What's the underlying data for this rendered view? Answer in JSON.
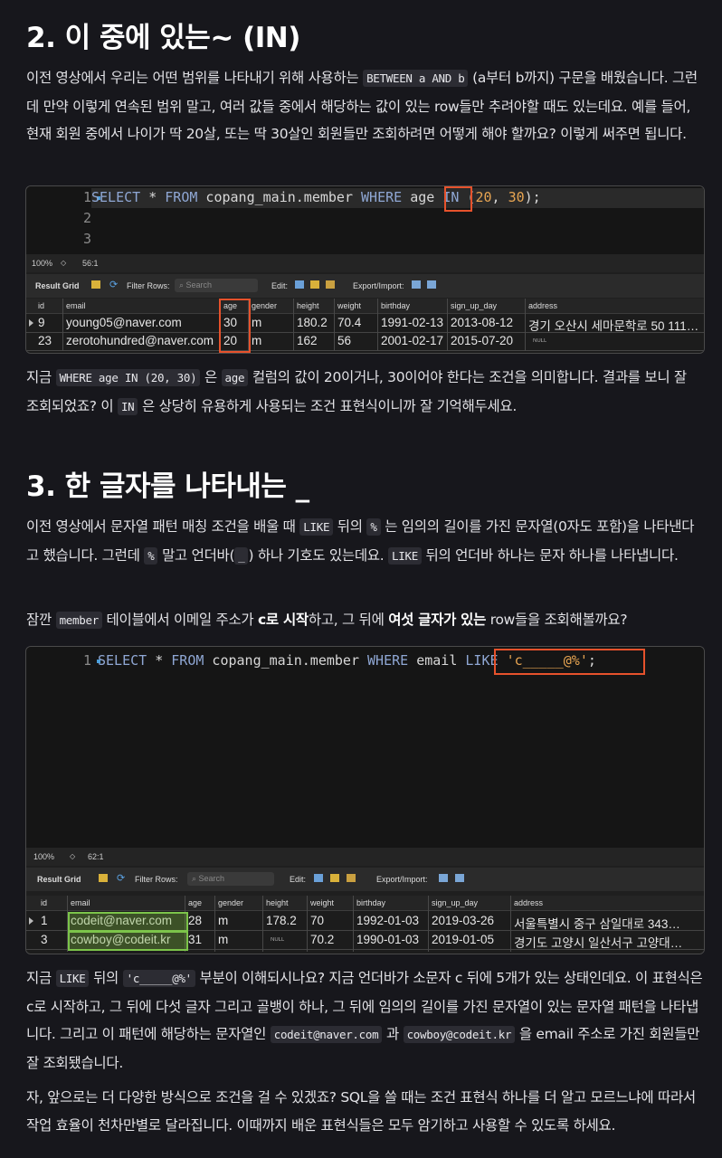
{
  "section2": {
    "title": "2. 이 중에 있는~ (IN)",
    "p1": {
      "t1": "이전 영상에서 우리는 어떤 범위를 나타내기 위해 사용하는 ",
      "code1": "BETWEEN a AND b",
      "t2": " (a부터 b까지) 구문을 배웠습니다. 그런데 만약 이렇게 연속된 범위 말고, 여러 값들 중에서 해당하는 값이 있는 row들만 추려야할 때도 있는데요. 예를 들어, 현재 회원 중에서 나이가 딱 20살, 또는 딱 30살인 회원들만 조회하려면 어떻게 해야 할까요? 이렇게 써주면 됩니다."
    },
    "shot": {
      "line_numbers": [
        "1",
        "2",
        "3"
      ],
      "code": {
        "kw1": "SELECT",
        "star": " * ",
        "kw2": "FROM",
        "tbl": " copang_main.member ",
        "kw3": "WHERE",
        "col": " age ",
        "kw4": "IN",
        "args_open": " (",
        "n1": "20",
        "comma": ", ",
        "n2": "30",
        "args_close": ");"
      },
      "zoom": "100%",
      "position": "56:1",
      "result_grid": "Result Grid",
      "filter_rows": "Filter Rows:",
      "search_placeholder": "Search",
      "edit": "Edit:",
      "export_import": "Export/Import:",
      "columns": [
        "id",
        "email",
        "age",
        "gender",
        "height",
        "weight",
        "birthday",
        "sign_up_day",
        "address"
      ],
      "rows": [
        {
          "id": "9",
          "email": "young05@naver.com",
          "age": "30",
          "gender": "m",
          "height": "180.2",
          "weight": "70.4",
          "birthday": "1991-02-13",
          "sign_up_day": "2013-08-12",
          "address": "경기 오산시 세마문학로 50 111…"
        },
        {
          "id": "23",
          "email": "zerotohundred@naver.com",
          "age": "20",
          "gender": "m",
          "height": "162",
          "weight": "56",
          "birthday": "2001-02-17",
          "sign_up_day": "2015-07-20",
          "address": "NULL"
        }
      ]
    },
    "p2": {
      "t1": "지금 ",
      "code1": "WHERE age IN (20, 30)",
      "t2": " 은 ",
      "code2": "age",
      "t3": " 컬럼의 값이 20이거나, 30이어야 한다는 조건을 의미합니다. 결과를 보니 잘 조회되었죠? 이 ",
      "code3": "IN",
      "t4": " 은 상당히 유용하게 사용되는 조건 표현식이니까 잘 기억해두세요."
    }
  },
  "section3": {
    "title": "3. 한 글자를 나타내는 _",
    "p1": {
      "t1": "이전 영상에서 문자열 패턴 매칭 조건을 배울 때 ",
      "code1": "LIKE",
      "t2": " 뒤의 ",
      "code2": "%",
      "t3": " 는 임의의 길이를 가진 문자열(0자도 포함)을 나타낸다고 했습니다. 그런데 ",
      "code3": "%",
      "t4": " 말고 언더바(",
      "code4": "_",
      "t5": ") 하나 기호도 있는데요. ",
      "code5": "LIKE",
      "t6": " 뒤의 언더바 하나는 문자 하나를 나타냅니다."
    },
    "p2": {
      "t1": "잠깐 ",
      "code1": "member",
      "t2": " 테이블에서 이메일 주소가 ",
      "b1": "c로 시작",
      "t3": "하고, 그 뒤에 ",
      "b2": "여섯 글자가 있는",
      "t4": " row들을 조회해볼까요?"
    },
    "shot": {
      "line_numbers": [
        "1"
      ],
      "code": {
        "kw1": "SELECT",
        "star": " * ",
        "kw2": "FROM",
        "tbl": " copang_main.member ",
        "kw3": "WHERE",
        "col": " email ",
        "kw4": "LIKE",
        "sp": " ",
        "str": "'c_____@%'",
        "semi": ";"
      },
      "zoom": "100%",
      "position": "62:1",
      "result_grid": "Result Grid",
      "filter_rows": "Filter Rows:",
      "search_placeholder": "Search",
      "edit": "Edit:",
      "export_import": "Export/Import:",
      "columns": [
        "id",
        "email",
        "age",
        "gender",
        "height",
        "weight",
        "birthday",
        "sign_up_day",
        "address"
      ],
      "rows": [
        {
          "id": "1",
          "email": "codeit@naver.com",
          "age": "28",
          "gender": "m",
          "height": "178.2",
          "weight": "70",
          "birthday": "1992-01-03",
          "sign_up_day": "2019-03-26",
          "address": "서울특별시 중구 삼일대로 343…"
        },
        {
          "id": "3",
          "email": "cowboy@codeit.kr",
          "age": "31",
          "gender": "m",
          "height": "NULL",
          "weight": "70.2",
          "birthday": "1990-01-03",
          "sign_up_day": "2019-01-05",
          "address": "경기도 고양시 일산서구 고양대…"
        }
      ]
    },
    "p3": {
      "t1": "지금 ",
      "code1": "LIKE",
      "t2": " 뒤의 ",
      "code2": "'c_____@%'",
      "t3": " 부분이 이해되시나요? 지금 언더바가 소문자 c 뒤에 5개가 있는 상태인데요. 이 표현식은 c로 시작하고, 그 뒤에 다섯 글자 그리고 골뱅이 하나, 그 뒤에 임의의 길이를 가진 문자열이 있는 문자열 패턴을 나타냅니다. 그리고 이 패턴에 해당하는 문자열인 ",
      "code3": "codeit@naver.com",
      "t4": " 과 ",
      "code4": "cowboy@codeit.kr",
      "t5": " 을 email 주소로 가진 회원들만 잘 조회됐습니다."
    },
    "p4": "자, 앞으로는 더 다양한 방식으로 조건을 걸 수 있겠죠? SQL을 쓸 때는 조건 표현식 하나를 더 알고 모르느냐에 따라서 작업 효율이 천차만별로 달라집니다. 이때까지 배운 표현식들은 모두 암기하고 사용할 수 있도록 하세요."
  }
}
